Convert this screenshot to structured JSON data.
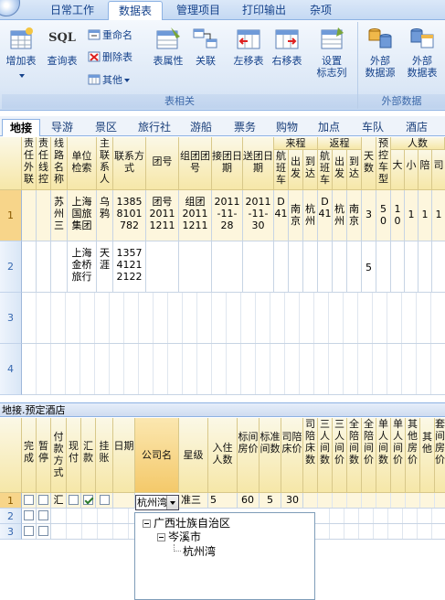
{
  "ribbon": {
    "tabs": [
      "日常工作",
      "数据表",
      "管理项目",
      "打印输出",
      "杂项"
    ],
    "active_tab": "数据表",
    "buttons": {
      "add_table": "增加表",
      "query_table": "查询表",
      "rename": "重命名",
      "delete_table": "删除表",
      "other": "其他",
      "table_props": "表属性",
      "relate": "关联",
      "move_left": "左移表",
      "move_right": "右移表",
      "set_flag_col_1": "设置",
      "set_flag_col_2": "标志列",
      "ext_source_1": "外部",
      "ext_source_2": "数据源",
      "ext_table_1": "外部",
      "ext_table_2": "数据表"
    },
    "groups": [
      "表相关",
      "外部数据"
    ],
    "sql_label": "SQL"
  },
  "category_tabs": [
    "地接",
    "导游",
    "景区",
    "旅行社",
    "游船",
    "票务",
    "购物",
    "加点",
    "车队",
    "酒店"
  ],
  "active_category": "地接",
  "top_grid": {
    "headers": [
      "责任外联",
      "责任线控",
      "线路名称",
      "单位检索",
      "主联系人",
      "联系方式",
      "团号",
      "组团团号",
      "接团日期",
      "送团日期",
      "航班车",
      "出发",
      "到达",
      "航班车",
      "出发",
      "到达",
      "天数",
      "预控车型",
      "大",
      "小",
      "陪",
      "司"
    ],
    "group_headers": [
      "来程",
      "返程",
      "人数"
    ],
    "rows": [
      {
        "num": "1",
        "route": "苏州三",
        "unit": "上海国旅集团",
        "contact": "乌鸦",
        "phone": "1385 8101 782",
        "group_no": "团号 2011 1211",
        "org_no": "组团 2011 1211",
        "recv": "2011 -11- 28",
        "send": "2011 -11- 30",
        "come_flight": "D 41",
        "come_from": "南京",
        "come_to": "杭州",
        "back_flight": "D 41",
        "back_from": "杭州",
        "back_to": "南京",
        "days": "3",
        "car": "5 0",
        "big": "1 0",
        "small": "1",
        "guide": "1",
        "driver": "1"
      },
      {
        "num": "2",
        "route": "",
        "unit": "上海金桥旅行",
        "contact": "天涯",
        "phone": "1357 4121 2122",
        "days": "5"
      },
      {
        "num": "3"
      },
      {
        "num": "4"
      }
    ]
  },
  "sub_section_title": "地接.预定酒店",
  "bottom_grid": {
    "headers": [
      "完成",
      "暂停",
      "付款方式",
      "现付",
      "汇款",
      "挂账",
      "日期",
      "公司名",
      "星级",
      "入住人数",
      "标间房价",
      "标准间数",
      "司陪床价",
      "司陪床数",
      "三人间数",
      "三人间价",
      "全陪间数",
      "全陪间价",
      "单人间数",
      "单人间价",
      "其他房价",
      "其他",
      "套间房价"
    ],
    "rows": [
      {
        "num": "1",
        "pay": "汇",
        "company": "杭州湾",
        "star": "准三",
        "guests": "5",
        "std_price": "60",
        "std_count": "5",
        "escort_price": "30"
      },
      {
        "num": "2"
      },
      {
        "num": "3"
      }
    ]
  },
  "combo_value": "杭州湾",
  "tree": {
    "root": "广西壮族自治区",
    "child": "岑溪市",
    "leaf": "杭州湾"
  }
}
